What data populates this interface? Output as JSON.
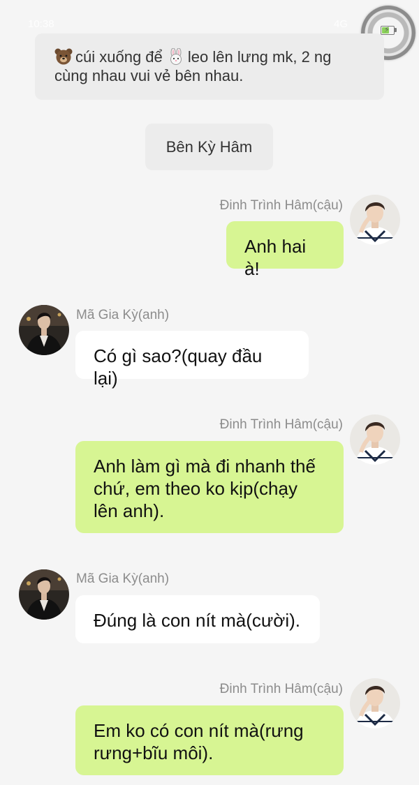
{
  "status_bar": {
    "time": "10:38",
    "network": "4G"
  },
  "colors": {
    "background": "#f5f5f5",
    "narration_bubble": "#ececec",
    "outgoing_bubble": "#d7f593",
    "incoming_bubble": "#ffffff",
    "name_label": "#8c8c8c"
  },
  "narrations": [
    {
      "icon_before": "bear-emoji",
      "text_a": "cúi xuống để",
      "icon_middle": "rabbit-emoji",
      "text_b": "leo lên lưng mk, 2 ng cùng nhau vui vẻ bên nhau."
    },
    {
      "text": "Bên Kỳ Hâm"
    }
  ],
  "messages": [
    {
      "side": "right",
      "sender": "Đinh Trình Hâm(cậu)",
      "avatar": "ding-chengxin-avatar",
      "text": "Anh hai à!"
    },
    {
      "side": "left",
      "sender": "Mã Gia Kỳ(anh)",
      "avatar": "ma-jiaqi-avatar",
      "text": "Có gì sao?(quay đầu lại)"
    },
    {
      "side": "right",
      "sender": "Đinh Trình Hâm(cậu)",
      "avatar": "ding-chengxin-avatar",
      "text": "Anh làm gì mà đi nhanh thế chứ, em theo ko kịp(chạy lên anh)."
    },
    {
      "side": "left",
      "sender": "Mã Gia Kỳ(anh)",
      "avatar": "ma-jiaqi-avatar",
      "text": "Đúng là con nít mà(cười)."
    },
    {
      "side": "right",
      "sender": "Đinh Trình Hâm(cậu)",
      "avatar": "ding-chengxin-avatar",
      "text": "Em ko có con nít mà(rưng rưng+bĩu môi)."
    }
  ]
}
